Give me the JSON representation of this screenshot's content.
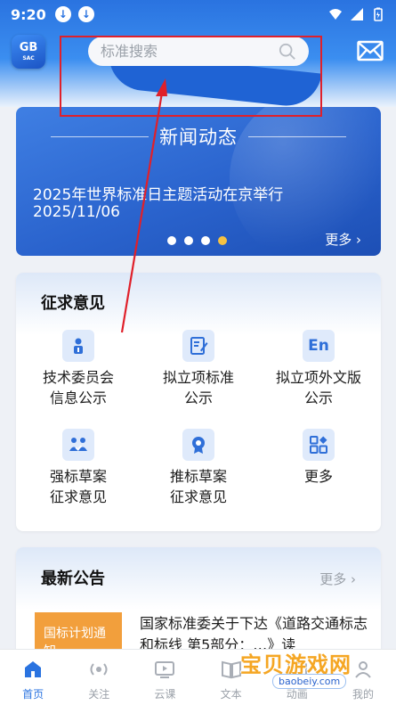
{
  "status_bar": {
    "time": "9:20"
  },
  "header": {
    "logo_text": "GB",
    "logo_sub": "SAC",
    "search_placeholder": "标准搜索"
  },
  "news": {
    "title": "新闻动态",
    "headline": "2025年世界标准日主题活动在京举行",
    "date": "2025/11/06",
    "more": "更多",
    "active_dot": 3
  },
  "solicit": {
    "title": "征求意见",
    "items": [
      {
        "label_line1": "技术委员会",
        "label_line2": "信息公示",
        "icon": "person-info-icon"
      },
      {
        "label_line1": "拟立项标准",
        "label_line2": "公示",
        "icon": "document-edit-icon"
      },
      {
        "label_line1": "拟立项外文版",
        "label_line2": "公示",
        "icon": "en-icon"
      },
      {
        "label_line1": "强标草案",
        "label_line2": "征求意见",
        "icon": "people-check-icon"
      },
      {
        "label_line1": "推标草案",
        "label_line2": "征求意见",
        "icon": "badge-gear-icon"
      },
      {
        "label_line1": "更多",
        "label_line2": "",
        "icon": "grid-more-icon"
      }
    ]
  },
  "notices": {
    "title": "最新公告",
    "more": "更多",
    "tag": "国标计划通知",
    "text": "国家标准委关于下达《道路交通标志和标线 第5部分：…》读"
  },
  "bottom_nav": [
    {
      "label": "首页",
      "icon": "home-icon",
      "active": true
    },
    {
      "label": "关注",
      "icon": "broadcast-icon",
      "active": false
    },
    {
      "label": "云课",
      "icon": "video-icon",
      "active": false
    },
    {
      "label": "文本",
      "icon": "book-icon",
      "active": false
    },
    {
      "label": "动画",
      "icon": "animation-icon",
      "active": false
    },
    {
      "label": "我的",
      "icon": "user-icon",
      "active": false
    }
  ],
  "watermark": {
    "text": "宝贝游戏网",
    "url": "baobeiy.com"
  },
  "colors": {
    "primary": "#2a73e0",
    "accent_dot": "#f5c142",
    "tag_orange": "#f29f3c",
    "annotation_red": "#e0202a"
  }
}
